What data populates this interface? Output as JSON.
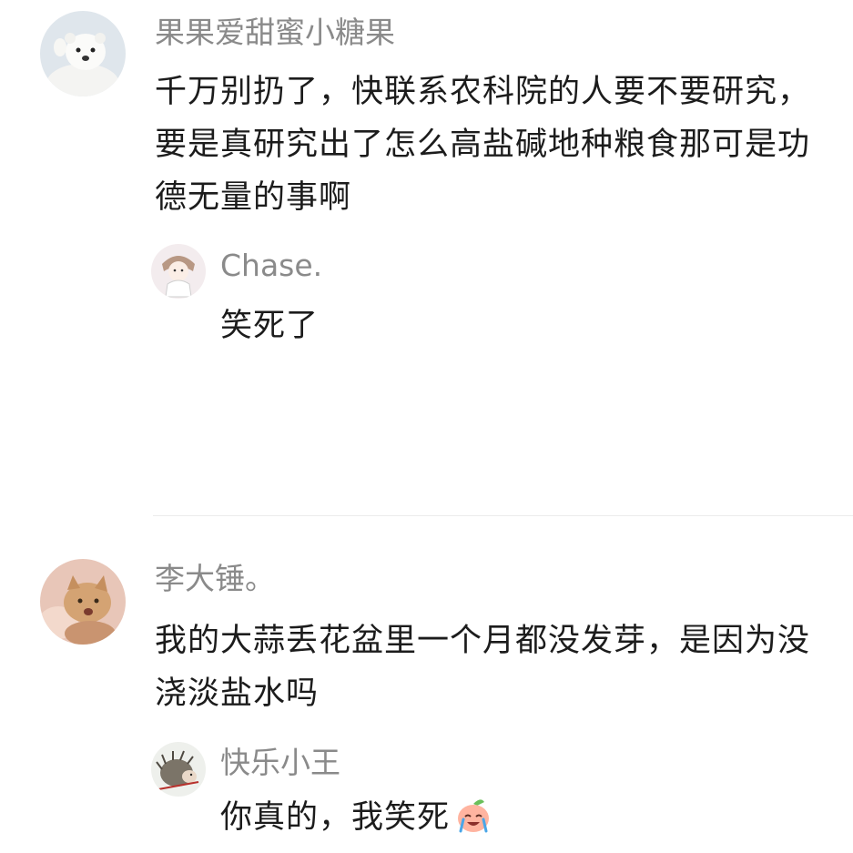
{
  "comments": [
    {
      "username": "果果爱甜蜜小糖果",
      "avatar_icon": "white-otter-avatar",
      "text": "千万别扔了，快联系农科院的人要不要研究，要是真研究出了怎么高盐碱地种粮食那可是功德无量的事啊",
      "reply": {
        "username": "Chase.",
        "avatar_icon": "cartoon-girl-avatar",
        "text": "笑死了"
      }
    },
    {
      "username": "李大锤。",
      "avatar_icon": "cat-avatar",
      "text": "我的大蒜丢花盆里一个月都没发芽，是因为没浇淡盐水吗",
      "reply": {
        "username": "快乐小王",
        "avatar_icon": "hedgehog-avatar",
        "text": "你真的，我笑死",
        "emoji": "crying-laughing-peach-emoji"
      }
    }
  ],
  "colors": {
    "username": "#8a8a8a",
    "text": "#1c1c1c",
    "divider": "#ececec",
    "background": "#ffffff"
  }
}
